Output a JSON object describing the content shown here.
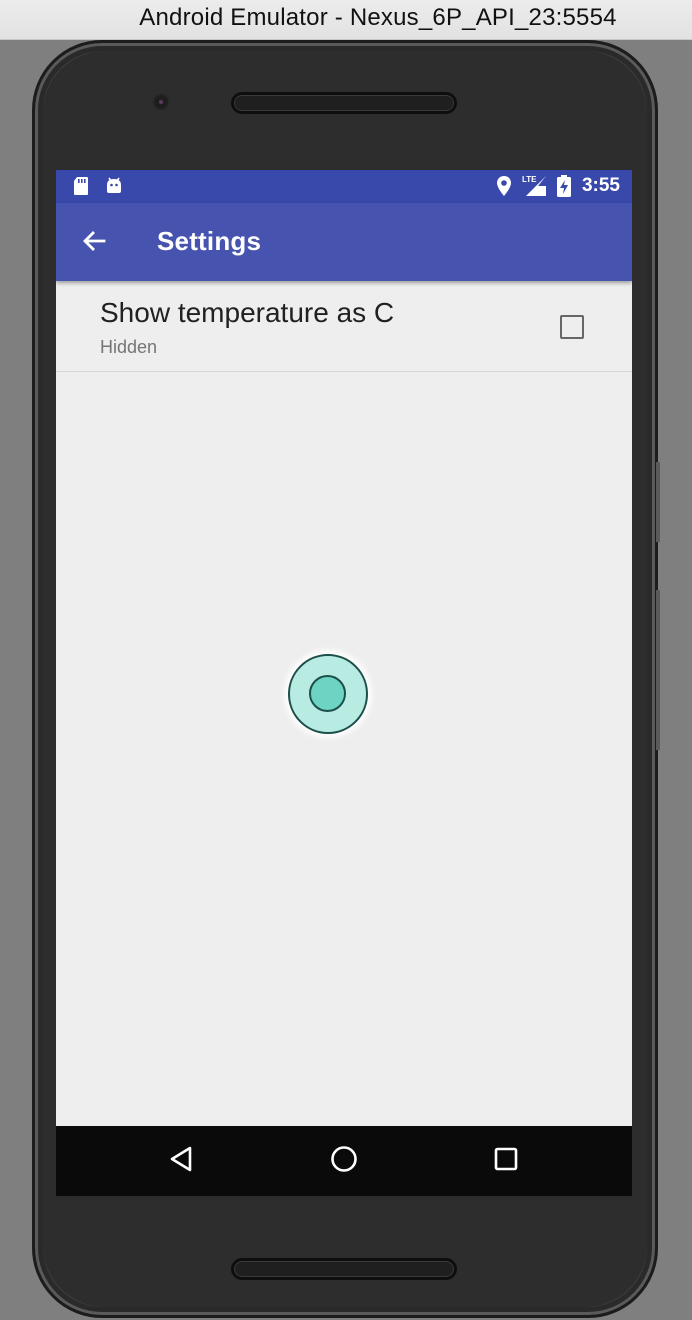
{
  "window": {
    "title": "Android Emulator - Nexus_6P_API_23:5554"
  },
  "status_bar": {
    "time": "3:55",
    "network_label": "LTE",
    "left_icons": [
      "sd-card-icon",
      "android-icon"
    ],
    "right_icons": [
      "location-icon",
      "lte-signal-icon",
      "battery-charging-icon"
    ]
  },
  "app_bar": {
    "title": "Settings",
    "back_icon": "arrow-back-icon",
    "color": "#4754af"
  },
  "preferences": [
    {
      "title": "Show temperature as C",
      "summary": "Hidden",
      "checked": false
    }
  ],
  "nav_bar": {
    "buttons": [
      "back-triangle-icon",
      "home-circle-icon",
      "recents-square-icon"
    ]
  },
  "colors": {
    "status_bar": "#3949ab",
    "app_bar": "#4754af",
    "screen_background": "#eeeeee",
    "touch_indicator": "#6dd4c3"
  }
}
